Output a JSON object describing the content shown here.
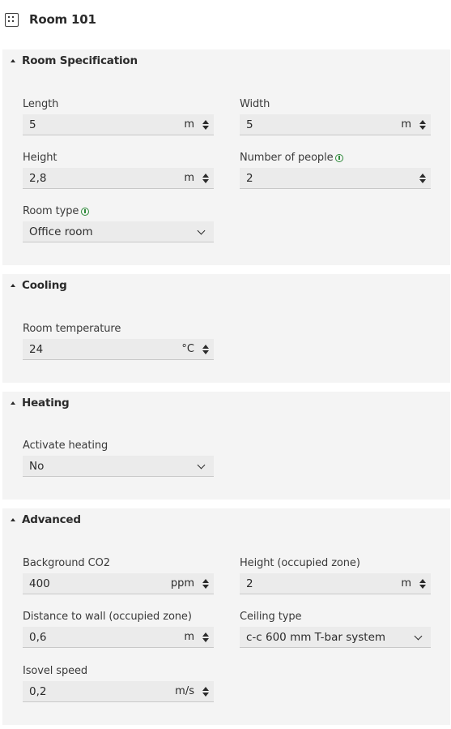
{
  "header": {
    "title": "Room 101",
    "icon": "room-grid-icon"
  },
  "sections": {
    "spec": {
      "title": "Room Specification",
      "length": {
        "label": "Length",
        "value": "5",
        "unit": "m"
      },
      "width": {
        "label": "Width",
        "value": "5",
        "unit": "m"
      },
      "height": {
        "label": "Height",
        "value": "2,8",
        "unit": "m"
      },
      "people": {
        "label": "Number of people",
        "value": "2"
      },
      "room_type": {
        "label": "Room type",
        "value": "Office room"
      }
    },
    "cooling": {
      "title": "Cooling",
      "temp": {
        "label": "Room temperature",
        "value": "24",
        "unit": "°C"
      }
    },
    "heating": {
      "title": "Heating",
      "activate": {
        "label": "Activate heating",
        "value": "No"
      }
    },
    "advanced": {
      "title": "Advanced",
      "co2": {
        "label": "Background CO2",
        "value": "400",
        "unit": "ppm"
      },
      "occ_height": {
        "label": "Height (occupied zone)",
        "value": "2",
        "unit": "m"
      },
      "wall_dist": {
        "label": "Distance to wall (occupied zone)",
        "value": "0,6",
        "unit": "m"
      },
      "ceiling": {
        "label": "Ceiling type",
        "value": "c-c 600 mm T-bar system"
      },
      "isovel": {
        "label": "Isovel speed",
        "value": "0,2",
        "unit": "m/s"
      }
    }
  },
  "colors": {
    "section_bg": "#f4f4f4",
    "input_bg": "#ebebeb",
    "info_accent": "#2e8a3a"
  }
}
